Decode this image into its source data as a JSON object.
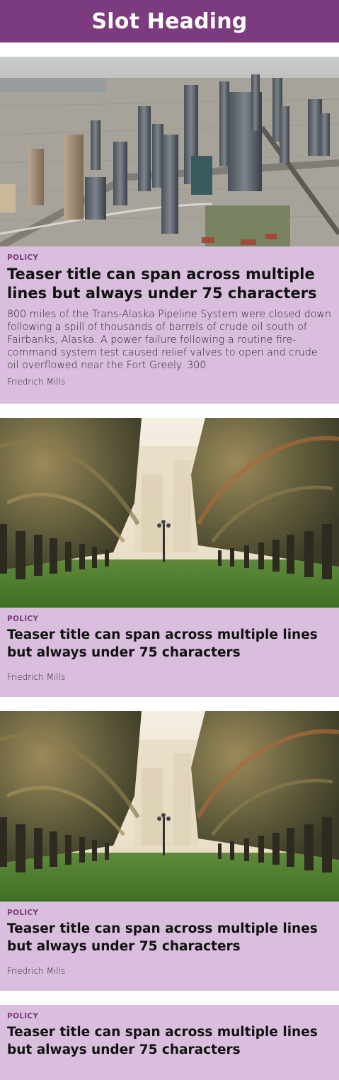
{
  "header": {
    "title": "Slot Heading"
  },
  "cards": [
    {
      "category": "POLICY",
      "title": "Teaser title can span across multiple lines but always under 75 characters",
      "description": "800 miles of the Trans-Alaska Pipeline System were closed down following a spill of thousands of barrels of crude oil south of Fairbanks, Alaska. A power failure following a routine fire-command system test caused relief valves to open and crude oil overflowed near the Fort Greely. 300",
      "author": "Friedrich Mills",
      "image": "city-skyline-aerial"
    },
    {
      "category": "POLICY",
      "title": "Teaser title can span across multiple lines but always under 75 characters",
      "author": "Friedrich Mills",
      "image": "palm-tree-avenue"
    },
    {
      "category": "POLICY",
      "title": "Teaser title can span across multiple lines but always under 75 characters",
      "author": "Friedrich Mills",
      "image": "palm-tree-avenue"
    },
    {
      "category": "POLICY",
      "title": "Teaser title can span across multiple lines but always under 75 characters"
    }
  ],
  "colors": {
    "header_bg": "#7b3b7e",
    "card_bg": "#d9bfdd",
    "kicker": "#7b3b7e"
  }
}
